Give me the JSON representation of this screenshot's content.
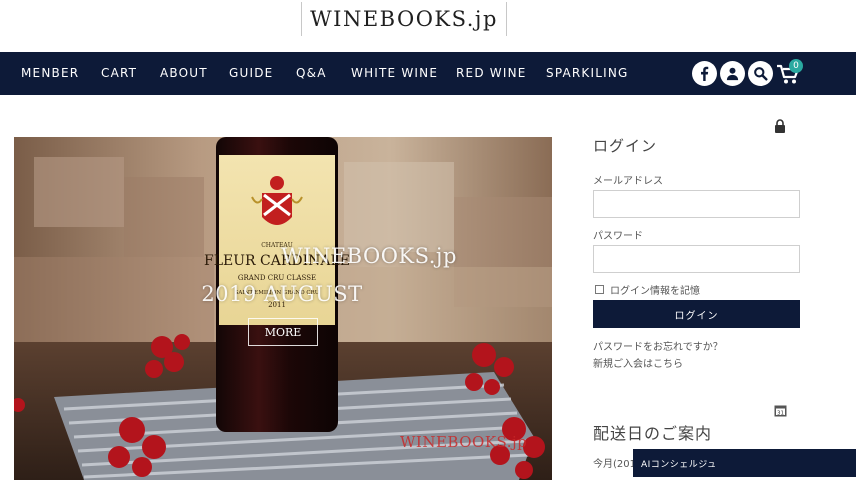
{
  "header": {
    "logo": "WINEBOOKS.jp"
  },
  "nav": {
    "items": [
      "MENBER",
      "CART",
      "ABOUT",
      "GUIDE",
      "Q&A",
      "WHITE WINE",
      "RED WINE",
      "SPARKILING"
    ],
    "icons": [
      "facebook-icon",
      "user-icon",
      "search-icon",
      "cart-icon"
    ],
    "cart_count": "0",
    "background": "#0d1a38"
  },
  "hero": {
    "title": "WINEBOOKS.jp",
    "date": "2019 AUGUST",
    "more_label": "MORE",
    "watermark": "WINEBOOKS.jp",
    "label": {
      "line1": "CHATEAU",
      "line2": "FLEUR CARDINALE",
      "line3": "GRAND CRU CLASSE",
      "line4": "SAINT-EMILION GRAND CRU",
      "year": "2011"
    }
  },
  "sidebar": {
    "login_title": "ログイン",
    "email_label": "メールアドレス",
    "password_label": "パスワード",
    "remember_label": "ログイン情報を記憶",
    "login_button": "ログイン",
    "forgot_link": "パスワードをお忘れですか？",
    "register_link": "新規ご入会はこちら",
    "delivery_title": "配送日のご案内",
    "delivery_text": "今月(201"
  },
  "ai_bar": {
    "label": "AIコンシェルジュ"
  }
}
